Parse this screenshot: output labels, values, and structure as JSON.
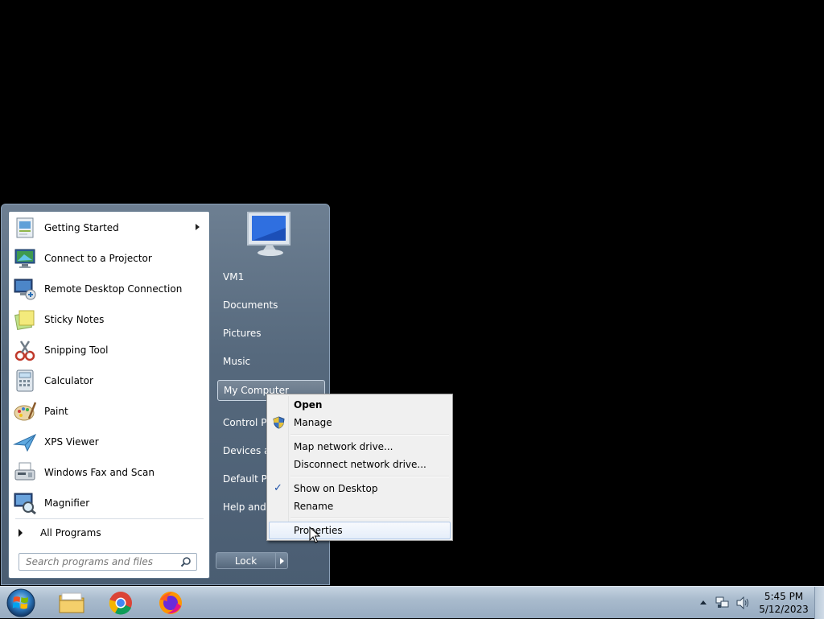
{
  "start_menu": {
    "programs": [
      {
        "label": "Getting Started",
        "icon": "getting-started-icon",
        "has_submenu": true
      },
      {
        "label": "Connect to a Projector",
        "icon": "projector-icon"
      },
      {
        "label": "Remote Desktop Connection",
        "icon": "remote-desktop-icon"
      },
      {
        "label": "Sticky Notes",
        "icon": "sticky-notes-icon"
      },
      {
        "label": "Snipping Tool",
        "icon": "snipping-tool-icon"
      },
      {
        "label": "Calculator",
        "icon": "calculator-icon"
      },
      {
        "label": "Paint",
        "icon": "paint-icon"
      },
      {
        "label": "XPS Viewer",
        "icon": "xps-viewer-icon"
      },
      {
        "label": "Windows Fax and Scan",
        "icon": "fax-scan-icon"
      },
      {
        "label": "Magnifier",
        "icon": "magnifier-icon"
      }
    ],
    "all_programs": "All Programs",
    "search_placeholder": "Search programs and files",
    "right_items": [
      {
        "label": "VM1"
      },
      {
        "label": "Documents"
      },
      {
        "label": "Pictures"
      },
      {
        "label": "Music"
      },
      {
        "label": "My Computer"
      },
      {
        "label": "Control Pa"
      },
      {
        "label": "Devices ar"
      },
      {
        "label": "Default Pr"
      },
      {
        "label": "Help and S"
      }
    ],
    "lock_label": "Lock"
  },
  "context_menu": {
    "items": [
      {
        "label": "Open",
        "bold": true
      },
      {
        "label": "Manage",
        "icon": "uac-shield-icon"
      },
      {
        "label": "Map network drive..."
      },
      {
        "label": "Disconnect network drive..."
      },
      {
        "label": "Show on Desktop",
        "checked": true
      },
      {
        "label": "Rename"
      },
      {
        "label": "Properties",
        "hover": true
      }
    ]
  },
  "taskbar": {
    "pinned": [
      {
        "name": "file-explorer-icon"
      },
      {
        "name": "chrome-icon"
      },
      {
        "name": "firefox-icon"
      }
    ],
    "clock": {
      "time": "5:45 PM",
      "date": "5/12/2023"
    }
  },
  "colors": {
    "desktop": "#000000",
    "menu_frame": "#56697d",
    "hover_border": "#b2c9e8"
  }
}
